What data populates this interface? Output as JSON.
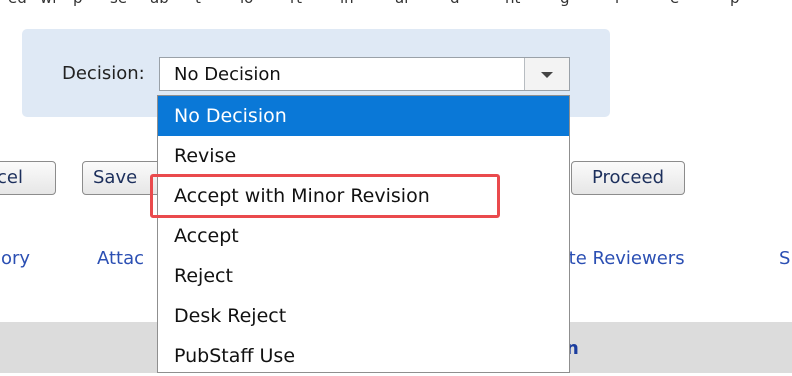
{
  "top_strip": {
    "fragments": [
      "ed",
      "wi",
      "p",
      "se",
      "ab",
      "t",
      "lo",
      "rt",
      "in",
      "ar",
      "d",
      "nt",
      "g",
      "r",
      "e",
      "p"
    ]
  },
  "decision": {
    "label": "Decision:",
    "selected_value": "No Decision",
    "options": [
      "No Decision",
      "Revise",
      "Accept with Minor Revision",
      "Accept",
      "Reject",
      "Desk Reject",
      "PubStaff Use"
    ],
    "highlighted_option": "Accept with Minor Revision"
  },
  "buttons": {
    "cancel_partial": "cel",
    "save_partial": "Save",
    "proceed": "Proceed"
  },
  "links": {
    "history_partial": "ory",
    "attachments_partial": "Attac",
    "invite_reviewers_partial": "vite Reviewers",
    "next_partial": "S"
  },
  "bottom_bar": {
    "partial_bold": "n"
  },
  "colors": {
    "panel_bg": "#dfe9f5",
    "selected_option_bg": "#0a78d7",
    "highlight_border": "#ea4a4d",
    "link_color": "#2b4fb3"
  }
}
